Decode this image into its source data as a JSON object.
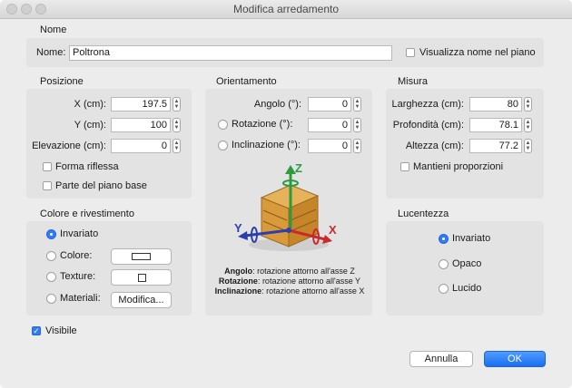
{
  "window": {
    "title": "Modifica arredamento"
  },
  "nome": {
    "section": "Nome",
    "label": "Nome:",
    "value": "Poltrona",
    "show_in_plan_label": "Visualizza nome nel piano"
  },
  "posizione": {
    "section": "Posizione",
    "x_label": "X (cm):",
    "x_value": "197.5",
    "y_label": "Y (cm):",
    "y_value": "100",
    "elev_label": "Elevazione (cm):",
    "elev_value": "0",
    "mirror_label": "Forma riflessa",
    "base_label": "Parte del piano base"
  },
  "orientamento": {
    "section": "Orientamento",
    "angle_label": "Angolo (°):",
    "angle_value": "0",
    "rotation_label": "Rotazione (°):",
    "rotation_value": "0",
    "tilt_label": "Inclinazione (°):",
    "tilt_value": "0",
    "legend_angle_bold": "Angolo",
    "legend_angle_text": ": rotazione attorno all'asse Z",
    "legend_rotation_bold": "Rotazione",
    "legend_rotation_text": ": rotazione attorno all'asse Y",
    "legend_tilt_bold": "Inclinazione",
    "legend_tilt_text": ": rotazione attorno all'asse X",
    "axis_z": "Z",
    "axis_y": "Y",
    "axis_x": "X"
  },
  "misura": {
    "section": "Misura",
    "width_label": "Larghezza (cm):",
    "width_value": "80",
    "depth_label": "Profondità (cm):",
    "depth_value": "78.1",
    "height_label": "Altezza (cm):",
    "height_value": "77.2",
    "keep_label": "Mantieni proporzioni"
  },
  "colore": {
    "section": "Colore e rivestimento",
    "unchanged_label": "Invariato",
    "color_label": "Colore:",
    "texture_label": "Texture:",
    "materials_label": "Materiali:",
    "modify_button": "Modifica..."
  },
  "lucentezza": {
    "section": "Lucentezza",
    "unchanged_label": "Invariato",
    "matte_label": "Opaco",
    "glossy_label": "Lucido"
  },
  "visible_label": "Visibile",
  "buttons": {
    "cancel": "Annulla",
    "ok": "OK"
  },
  "colors": {
    "accent": "#2f7cf6",
    "axis_z": "#2e9a3e",
    "axis_y": "#2b3fae",
    "axis_x": "#c92a2a"
  }
}
